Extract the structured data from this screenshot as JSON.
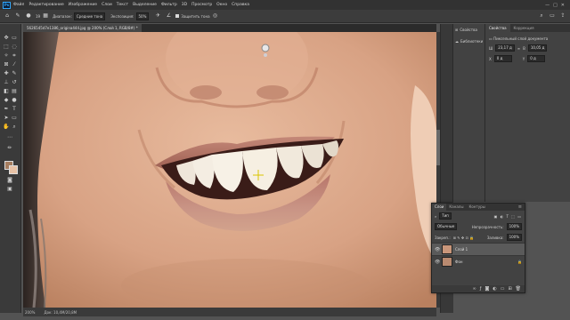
{
  "app": {
    "logo": "Ps"
  },
  "menubar": {
    "items": [
      "Файл",
      "Редактирование",
      "Изображение",
      "Слои",
      "Текст",
      "Выделение",
      "Фильтр",
      "3D",
      "Просмотр",
      "Окно",
      "Справка"
    ],
    "window_buttons": [
      "—",
      "□",
      "✕"
    ]
  },
  "options": {
    "brush_size": "19",
    "mode_label": "Диапазон:",
    "mode_value": "Средние тона",
    "exposure_label": "Экспозиция:",
    "exposure_value": "50%",
    "protect_tones_label": "Защитить тона"
  },
  "document": {
    "tab_title": "5626545d7e1386_origina444.jpg @ 200% (Слой 1, RGB/8#) *",
    "zoom": "200%",
    "doc_info": "Док: 10,4M/20,8M"
  },
  "history_panel": {
    "items": [
      "Свойства",
      "Библиотеки"
    ]
  },
  "properties": {
    "tabs": [
      "Свойства",
      "Коррекция"
    ],
    "title": "Пиксельный слой документа",
    "w_label": "Ш",
    "w_value": "23,17 д",
    "h_label": "В",
    "h_value": "10,05 д",
    "x_label": "X",
    "x_value": "0 д",
    "y_label": "Y",
    "y_value": "0 д"
  },
  "layers": {
    "tabs": [
      "Слои",
      "Каналы",
      "Контуры"
    ],
    "filter_kind": "Тип",
    "blend_mode": "Обычные",
    "opacity_label": "Непрозрачность:",
    "opacity_value": "100%",
    "lock_label": "Закреп.:",
    "fill_label": "Заливка:",
    "fill_value": "100%",
    "items": [
      {
        "name": "Слой 1"
      },
      {
        "name": "Фон"
      }
    ]
  }
}
